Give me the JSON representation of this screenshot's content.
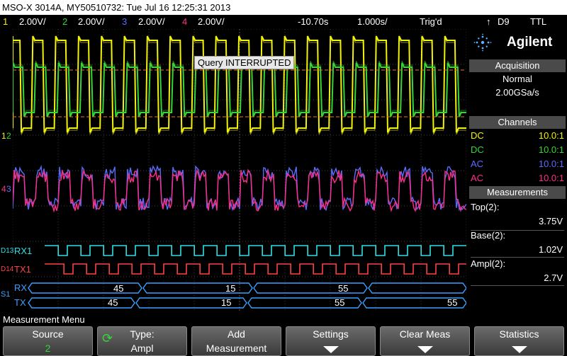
{
  "titlebar": {
    "text": "MSO-X 3014A, MY50510732: Tue Jul 16 12:25:31 2013"
  },
  "scalebar": {
    "ch1_num": "1",
    "ch1_scale": "2.00V/",
    "ch2_num": "2",
    "ch2_scale": "2.00V/",
    "ch3_num": "3",
    "ch3_scale": "2.00V/",
    "ch4_num": "4",
    "ch4_scale": "2.00V/",
    "time_offset": "-10.70s",
    "timebase": "1.000s/",
    "trig_status": "Trig'd",
    "trig_source": "D9",
    "trig_level": "TTL"
  },
  "colors": {
    "ch1": "#f2f20a",
    "ch2": "#35d635",
    "ch3": "#5a6cff",
    "ch4": "#ff2d8a",
    "d_rx": "#2de0e6",
    "d_tx": "#ff4040",
    "serial": "#3aa0ff"
  },
  "query": {
    "label": "Query INTERRUPTED"
  },
  "markers": {
    "ch1": "1",
    "ch2": "2",
    "ch3": "3",
    "ch4": "4",
    "rx": "D13",
    "tx": "D14",
    "s1": "S1"
  },
  "bus": {
    "rx_label": "RX1",
    "tx_label": "TX1",
    "s_rx": "RX",
    "s_tx": "TX",
    "rx_values": [
      "45",
      "15",
      "55"
    ],
    "tx_values": [
      "45",
      "15",
      "55",
      "55"
    ]
  },
  "panel": {
    "brand": "Agilent",
    "brand_icon": "agilent-spark-icon",
    "acquisition_title": "Acquisition",
    "acq_mode": "Normal",
    "acq_rate": "2.00GSa/s",
    "channels_title": "Channels",
    "channels": [
      {
        "coupling": "DC",
        "probe": "10.0:1"
      },
      {
        "coupling": "DC",
        "probe": "10.0:1"
      },
      {
        "coupling": "AC",
        "probe": "10.0:1"
      },
      {
        "coupling": "AC",
        "probe": "10.0:1"
      }
    ],
    "measurements_title": "Measurements",
    "measurements": [
      {
        "name": "Top(2):",
        "value": "3.75V"
      },
      {
        "name": "Base(2):",
        "value": "1.02V"
      },
      {
        "name": "Ampl(2):",
        "value": "2.7V"
      }
    ]
  },
  "menu": {
    "title": "Measurement Menu",
    "source_l1": "Source",
    "source_l2": "2",
    "type_l1": "Type:",
    "type_l2": "Ampl",
    "add_l1": "Add",
    "add_l2": "Measurement",
    "settings_l1": "Settings",
    "clear_l1": "Clear Meas",
    "stats_l1": "Statistics"
  }
}
